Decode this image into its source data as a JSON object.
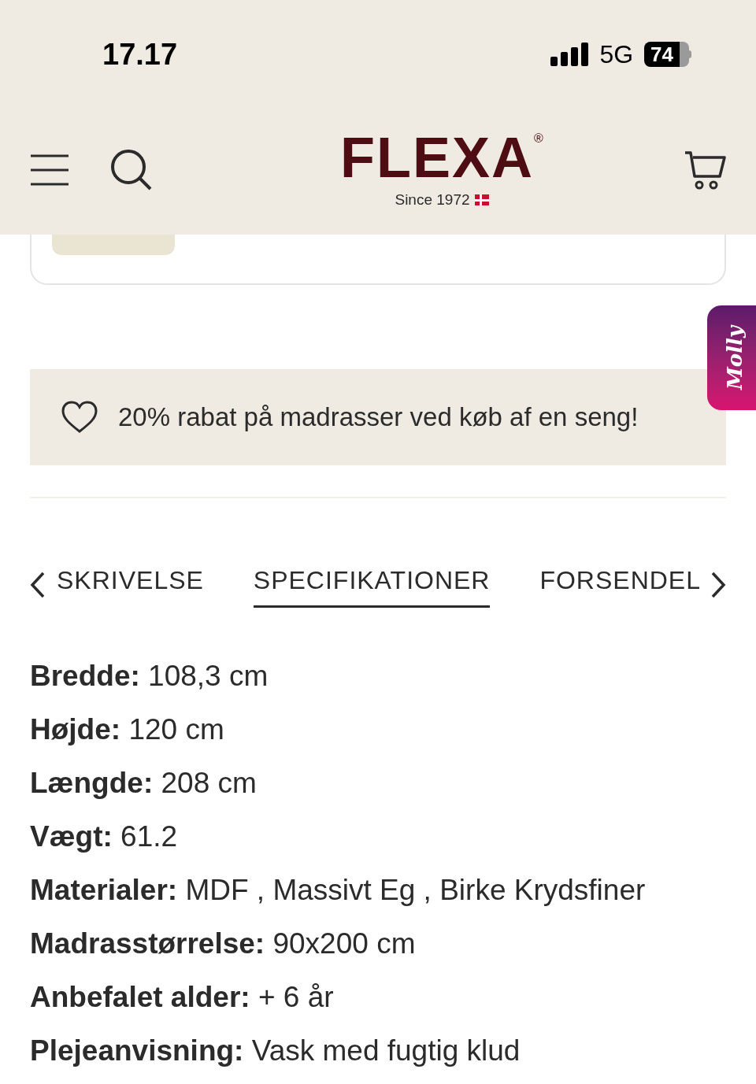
{
  "status_bar": {
    "time": "17.17",
    "network": "5G",
    "battery": "74"
  },
  "header": {
    "logo": "FLEXA",
    "logo_mark": "®",
    "tagline": "Since 1972"
  },
  "chat_tab": {
    "label": "Molly"
  },
  "banner": {
    "text": "20% rabat på madrasser ved køb af en seng!"
  },
  "tabs": [
    {
      "label": "SKRIVELSE",
      "selected": false
    },
    {
      "label": "SPECIFIKATIONER",
      "selected": true
    },
    {
      "label": "FORSENDEL",
      "selected": false
    }
  ],
  "specs": [
    "**Bredde:** 108,3 cm",
    "**Højde:** 120 cm",
    "**Længde:** 208 cm",
    "**Vægt:** 61.2",
    "**Materialer:** MDF , Massivt Eg , Birke Krydsfiner",
    "**Madrasstørrelse:** 90x200 cm",
    "**Anbefalet alder:** + 6 år",
    "**Plejeanvisning:** Vask med fugtig klud"
  ]
}
